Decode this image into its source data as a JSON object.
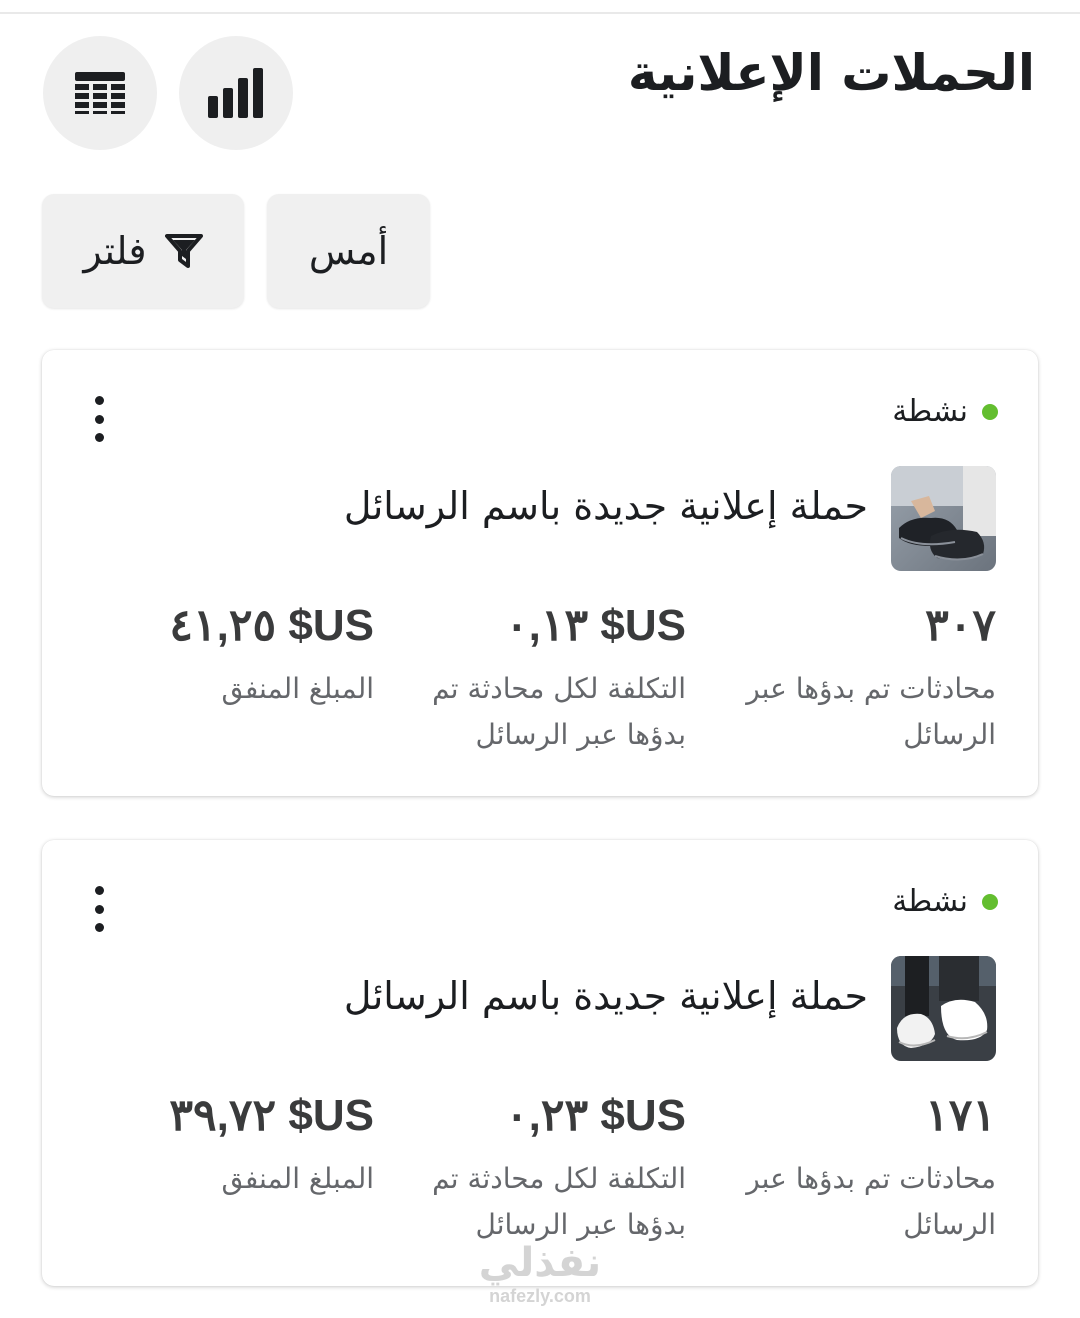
{
  "header": {
    "title": "الحملات الإعلانية",
    "chart_view_icon": "bar-chart-icon",
    "table_view_icon": "table-icon"
  },
  "toolbar": {
    "date_label": "أمس",
    "filter_label": "فلتر",
    "filter_icon": "funnel-icon"
  },
  "colors": {
    "active_status": "#63be2f",
    "button_bg": "#efefef",
    "metric_value": "#3a3b3c",
    "metric_label": "#65676b"
  },
  "campaigns": [
    {
      "status": "نشطة",
      "name": "حملة إعلانية جديدة باسم الرسائل",
      "thumbnail": "black-sneakers-photo",
      "metrics": [
        {
          "value": "٣٠٧",
          "label": "محادثات تم بدؤها عبر الرسائل"
        },
        {
          "value": "US$ ٠,١٣",
          "label": "التكلفة لكل محادثة تم بدؤها عبر الرسائل"
        },
        {
          "value": "US$ ٤١,٢٥",
          "label": "المبلغ المنفق"
        }
      ]
    },
    {
      "status": "نشطة",
      "name": "حملة إعلانية جديدة باسم الرسائل",
      "thumbnail": "white-sneakers-photo",
      "metrics": [
        {
          "value": "١٧١",
          "label": "محادثات تم بدؤها عبر الرسائل"
        },
        {
          "value": "US$ ٠,٢٣",
          "label": "التكلفة لكل محادثة تم بدؤها عبر الرسائل"
        },
        {
          "value": "US$ ٣٩,٧٢",
          "label": "المبلغ المنفق"
        }
      ]
    }
  ],
  "watermark": {
    "arabic": "نفذلي",
    "latin": "nafezly.com"
  }
}
